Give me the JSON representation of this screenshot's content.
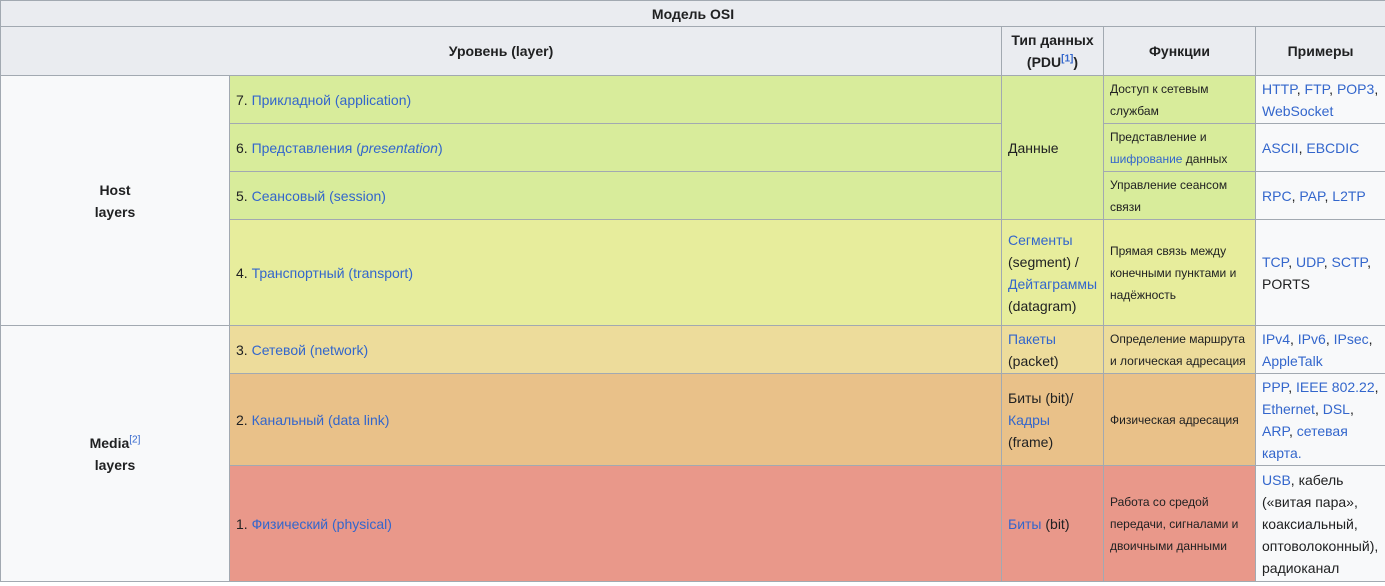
{
  "caption": "Модель OSI",
  "headers": {
    "level": "Уровень (layer)",
    "pdu_a": "Тип данных",
    "pdu_b": "(PDU",
    "pdu_ref": "[1]",
    "pdu_c": ")",
    "functions": "Функции",
    "examples": "Примеры"
  },
  "groups": {
    "host_a": "Host",
    "host_b": "layers",
    "media_a": "Media",
    "media_ref": "[2]",
    "media_b": "layers"
  },
  "rows": {
    "l7": {
      "num": "7.",
      "name": "Прикладной (application)",
      "func": "Доступ к сетевым службам",
      "ex": [
        "HTTP",
        "FTP",
        "POP3",
        "WebSocket"
      ]
    },
    "l6": {
      "num": "6.",
      "name": "Представления (",
      "name_it": "presentation",
      "name_end": ")",
      "func_a": "Представление и ",
      "func_link": "шифрование",
      "func_b": " данных",
      "ex": [
        "ASCII",
        "EBCDIC"
      ]
    },
    "l5": {
      "num": "5.",
      "name": "Сеансовый (session)",
      "func": "Управление сеансом связи",
      "ex": [
        "RPC",
        "PAP",
        "L2TP"
      ]
    },
    "l4": {
      "num": "4.",
      "name": "Транспортный (transport)",
      "pdu_link1": "Сегменты",
      "pdu_t1": "(segment) /",
      "pdu_link2": "Дейтаграммы",
      "pdu_t2": "(datagram)",
      "func": "Прямая связь между конечными пунктами и надёжность",
      "ex": [
        "TCP",
        "UDP",
        "SCTP"
      ],
      "ex_tail": "PORTS"
    },
    "l3": {
      "num": "3.",
      "name": "Сетевой (network)",
      "pdu_link": "Пакеты",
      "pdu_t": "(packet)",
      "func": "Определение маршрута и логическая адресация",
      "ex": [
        "IPv4",
        "IPv6",
        "IPsec",
        "AppleTalk"
      ]
    },
    "l2": {
      "num": "2.",
      "name": "Канальный (data link)",
      "pdu_t1": "Биты (bit)/",
      "pdu_link": "Кадры",
      "pdu_t2": "(frame)",
      "func": "Физическая адресация",
      "ex": [
        "PPP",
        "IEEE 802.22",
        "Ethernet",
        "DSL",
        "ARP",
        "сетевая карта."
      ]
    },
    "l1": {
      "num": "1.",
      "name": "Физический (physical)",
      "pdu_link": "Биты",
      "pdu_t": " (bit)",
      "func": "Работа со средой передачи, сигналами и двоичными данными",
      "ex_link": "USB",
      "ex_text": ", кабель («витая пара», коаксиальный, оптоволоконный), радиоканал"
    }
  },
  "pdu_data": "Данные"
}
